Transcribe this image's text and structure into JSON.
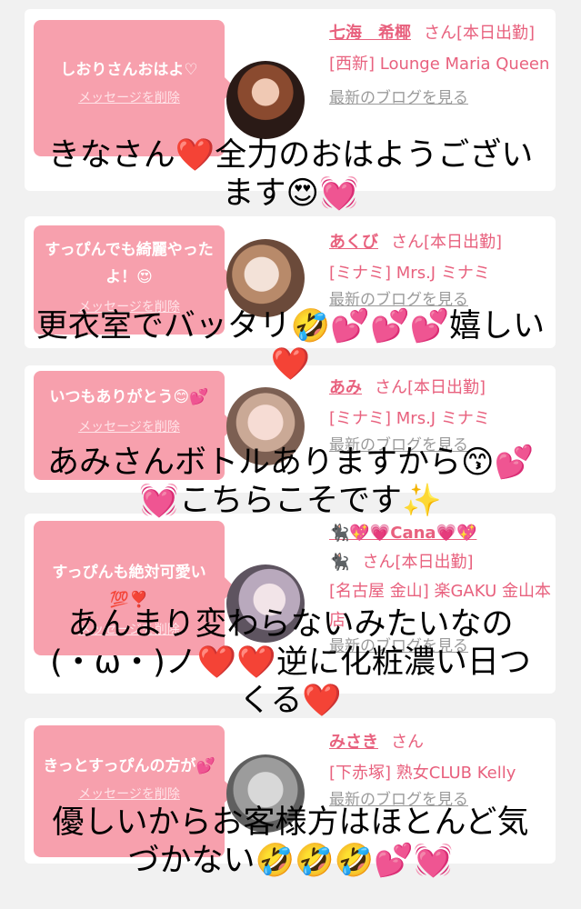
{
  "cards": [
    {
      "message": "しおりさんおはよ♡",
      "delete_label": "メッセージを削除",
      "name": "七海　希椰",
      "san_label": "さん[本日出勤]",
      "shop": "[西新] Lounge Maria Queen",
      "blog_label": "最新のブログを見る"
    },
    {
      "message": "すっぴんでも綺麗やったよ！😍",
      "delete_label": "メッセージを削除",
      "name": "あくび",
      "san_label": "さん[本日出勤]",
      "shop": "[ミナミ] Mrs.J ミナミ",
      "blog_label": "最新のブログを見る"
    },
    {
      "message": "いつもありがとう😊💕",
      "delete_label": "メッセージを削除",
      "name": "あみ",
      "san_label": "さん[本日出勤]",
      "shop": "[ミナミ] Mrs.J ミナミ",
      "blog_label": "最新のブログを見る"
    },
    {
      "message": "すっぴんも絶対可愛い💯❣️",
      "delete_label": "メッセージを削除",
      "name": "🐈‍⬛💖💗Cana💗💖",
      "name2": "🐈‍⬛",
      "san_label": "さん[本日出勤]",
      "shop": "[名古屋 金山] 楽GAKU 金山本店",
      "blog_label": "最新のブログを見る"
    },
    {
      "message": "きっとすっぴんの方が💕",
      "delete_label": "メッセージを削除",
      "name": "みさき",
      "san_label": "さん",
      "shop": "[下赤塚] 熟女CLUB Kelly",
      "blog_label": "最新のブログを見る"
    }
  ],
  "overlays": [
    {
      "line1": "きなさん❤️全力のおはようござい",
      "line2": "ます😍💓"
    },
    {
      "line1": "更衣室でバッタリ🤣💕💕💕嬉しい",
      "line2": "❤️"
    },
    {
      "line1": "あみさんボトルありますから😙💕",
      "line2": "💓こちらこそです✨"
    },
    {
      "line1": "あんまり変わらないみたいなの",
      "line2": "(・ω・)ノ❤️❤️逆に化粧濃い日つ",
      "line3": "くる❤️"
    },
    {
      "line1": "優しいからお客様方はほとんど気",
      "line2": "づかない🤣🤣🤣💕💓"
    }
  ],
  "colors": {
    "bubble": "#f7a0ad",
    "accent": "#e8617e",
    "link_gray": "#9a9a9a",
    "background": "#f1f1f1"
  }
}
